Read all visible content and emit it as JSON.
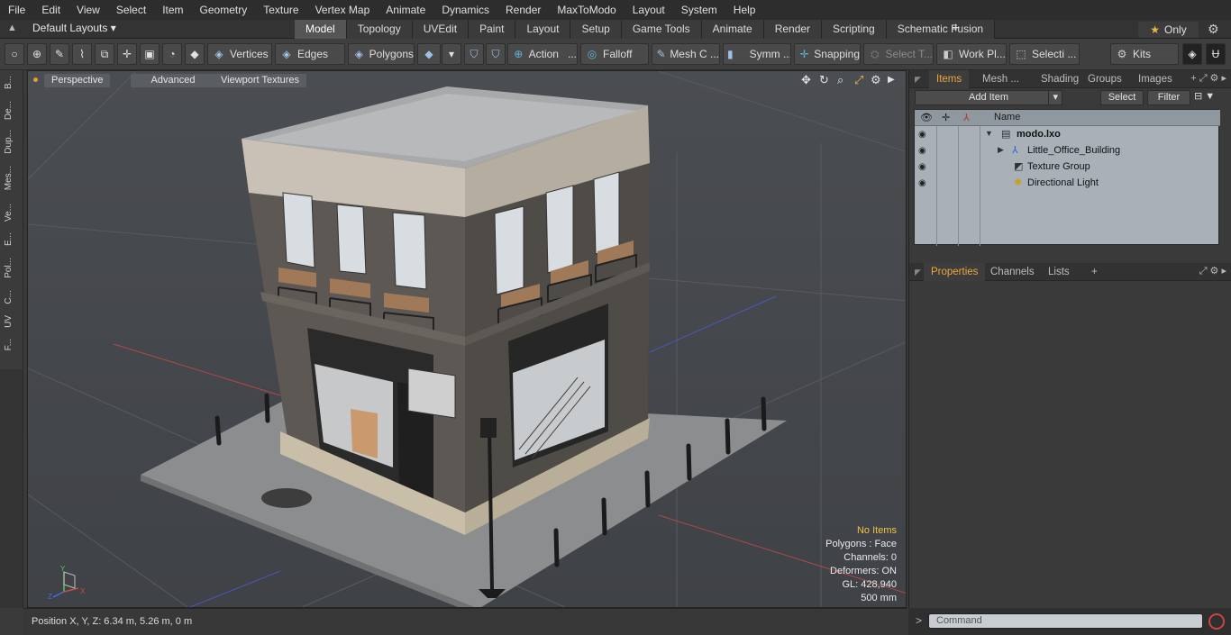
{
  "menu": [
    "File",
    "Edit",
    "View",
    "Select",
    "Item",
    "Geometry",
    "Texture",
    "Vertex Map",
    "Animate",
    "Dynamics",
    "Render",
    "MaxToModo",
    "Layout",
    "System",
    "Help"
  ],
  "layoutbar": {
    "layout_select": "Default Layouts ▾",
    "tabs": [
      "Model",
      "Topology",
      "UVEdit",
      "Paint",
      "Layout",
      "Setup",
      "Game Tools",
      "Animate",
      "Render",
      "Scripting",
      "Schematic Fusion"
    ],
    "active_tab": "Model",
    "plus": "+",
    "only": "Only"
  },
  "toolbar": {
    "vertices": "Vertices",
    "edges": "Edges",
    "polygons": "Polygons",
    "action": "Action",
    "falloff": "Falloff",
    "mesh_c": "Mesh C ...",
    "symm": "Symm ...",
    "snapping": "Snapping",
    "select_t": "Select T...",
    "work_pl": "Work Pl...",
    "selecti": "Selecti ...",
    "kits": "Kits"
  },
  "left_tabs": [
    "B...",
    "De...",
    "Dup...",
    "Mes...",
    "Ve...",
    "E...",
    "Pol...",
    "C...",
    "UV",
    "F..."
  ],
  "viewport": {
    "perspective": "Perspective",
    "advanced": "Advanced",
    "viewport_textures": "Viewport Textures",
    "info": {
      "no_items": "No Items",
      "polygons": "Polygons : Face",
      "channels": "Channels: 0",
      "deformers": "Deformers: ON",
      "gl": "GL: 428,940",
      "scale": "500 mm"
    },
    "axis": {
      "x": "X",
      "y": "Y",
      "z": "Z"
    }
  },
  "status": {
    "position": "Position X, Y, Z:   6.34 m, 5.26 m, 0 m"
  },
  "items_panel": {
    "tabs": [
      "Items",
      "Mesh ...",
      "Shading",
      "Groups",
      "Images"
    ],
    "active": "Items",
    "add_item": "Add Item",
    "select": "Select",
    "filter": "Filter",
    "header_name": "Name",
    "rows": [
      {
        "name": "modo.lxo",
        "icon": "scene-icon"
      },
      {
        "name": "Little_Office_Building",
        "icon": "mesh-icon"
      },
      {
        "name": "Texture Group",
        "icon": "texture-group-icon"
      },
      {
        "name": "Directional Light",
        "icon": "light-icon"
      }
    ]
  },
  "props_panel": {
    "tabs": [
      "Properties",
      "Channels",
      "Lists"
    ],
    "active": "Properties"
  },
  "command": {
    "placeholder": "Command"
  },
  "colors": {
    "accent": "#f0a43a",
    "active_tab_bg": "#555555",
    "list_bg": "#a9b0b8",
    "viewport_bg": "#4b4e52"
  }
}
